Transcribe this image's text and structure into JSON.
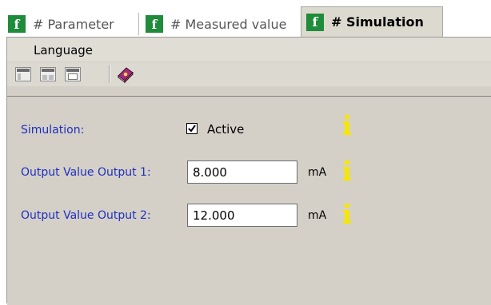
{
  "tabs": [
    {
      "label": "# Parameter",
      "active": false
    },
    {
      "label": "# Measured value",
      "active": false
    },
    {
      "label": "# Simulation",
      "active": true
    }
  ],
  "menu": {
    "language_label": "Language"
  },
  "toolbar": {
    "buttons": [
      "layout-1-icon",
      "layout-2-icon",
      "layout-3-icon",
      "help-book-icon"
    ]
  },
  "form": {
    "simulation_label": "Simulation:",
    "active_checked": true,
    "active_label": "Active",
    "output1_label": "Output Value Output 1:",
    "output1_value": "8.000",
    "output1_unit": "mA",
    "output2_label": "Output Value Output 2:",
    "output2_value": "12.000",
    "output2_unit": "mA"
  },
  "colors": {
    "logo_green": "#1e8c3a",
    "label_blue": "#1f2fbf",
    "info_yellow": "#f7e600",
    "panel_bg": "#d4d0c8"
  }
}
